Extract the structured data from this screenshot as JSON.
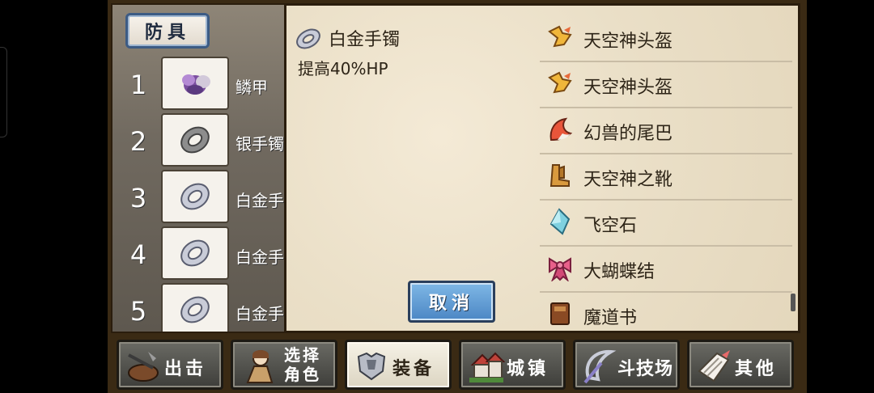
{
  "category_tab": "防具",
  "slots": [
    {
      "num": "1",
      "name": "鳞甲",
      "icon": "scale-armor-icon"
    },
    {
      "num": "2",
      "name": "银手镯",
      "icon": "bracelet-icon"
    },
    {
      "num": "3",
      "name": "白金手",
      "icon": "bracelet-icon"
    },
    {
      "num": "4",
      "name": "白金手",
      "icon": "bracelet-icon"
    },
    {
      "num": "5",
      "name": "白金手",
      "icon": "bracelet-icon"
    }
  ],
  "detail": {
    "name": "白金手镯",
    "description": "提高40%HP",
    "cancel_label": "取消"
  },
  "list": [
    {
      "label": "天空神头盔",
      "icon": "helmet-icon"
    },
    {
      "label": "天空神头盔",
      "icon": "helmet-icon"
    },
    {
      "label": "幻兽的尾巴",
      "icon": "tail-icon"
    },
    {
      "label": "天空神之靴",
      "icon": "boots-icon"
    },
    {
      "label": "飞空石",
      "icon": "crystal-icon"
    },
    {
      "label": "大蝴蝶结",
      "icon": "ribbon-icon"
    },
    {
      "label": "魔道书",
      "icon": "book-icon"
    }
  ],
  "nav": [
    {
      "label": "出击",
      "icon": "sortie-icon"
    },
    {
      "label": "选择角色",
      "label_line1": "选择",
      "label_line2": "角色",
      "icon": "character-icon"
    },
    {
      "label": "装备",
      "icon": "armor-icon",
      "active": true
    },
    {
      "label": "城镇",
      "icon": "town-icon"
    },
    {
      "label": "斗技场",
      "icon": "arena-icon"
    },
    {
      "label": "其他",
      "icon": "other-icon"
    }
  ]
}
